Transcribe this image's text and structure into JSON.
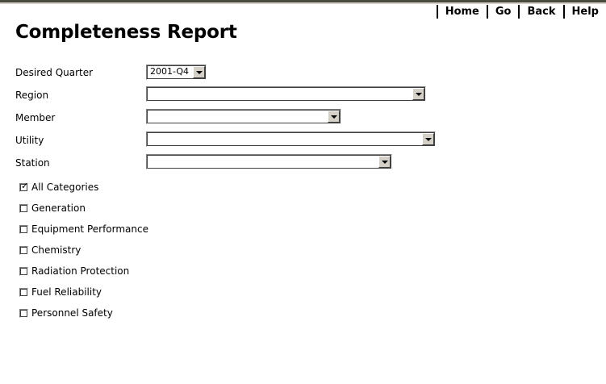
{
  "nav": {
    "home": "Home",
    "go": "Go",
    "back": "Back",
    "help": "Help"
  },
  "page": {
    "title": "Completeness Report"
  },
  "form": {
    "quarter": {
      "label": "Desired Quarter",
      "value": "2001-Q4"
    },
    "region": {
      "label": "Region",
      "value": ""
    },
    "member": {
      "label": "Member",
      "value": ""
    },
    "utility": {
      "label": "Utility",
      "value": ""
    },
    "station": {
      "label": "Station",
      "value": ""
    }
  },
  "categories": [
    {
      "label": "All Categories",
      "checked": true
    },
    {
      "label": "Generation",
      "checked": false
    },
    {
      "label": "Equipment Performance",
      "checked": false
    },
    {
      "label": "Chemistry",
      "checked": false
    },
    {
      "label": "Radiation Protection",
      "checked": false
    },
    {
      "label": "Fuel Reliability",
      "checked": false
    },
    {
      "label": "Personnel Safety",
      "checked": false
    }
  ],
  "icons": {
    "dropdown": "chevron-down-icon",
    "check": "checkmark-icon"
  }
}
